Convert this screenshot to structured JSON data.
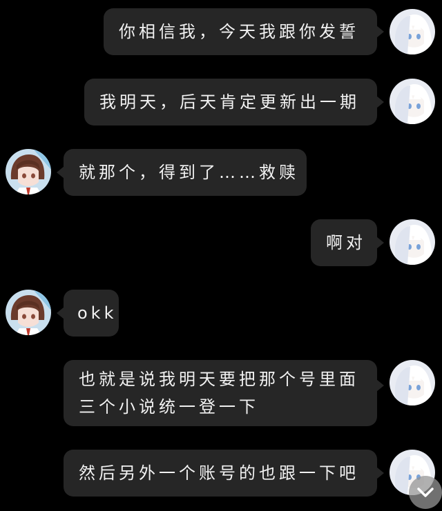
{
  "messages": [
    {
      "side": "right",
      "text": "你相信我，今天我跟你发誓"
    },
    {
      "side": "right",
      "text": "我明天，后天肯定更新出一期"
    },
    {
      "side": "left",
      "text": "就那个，得到了……救赎"
    },
    {
      "side": "right",
      "text": "啊对"
    },
    {
      "side": "left",
      "text": "okk"
    },
    {
      "side": "right",
      "lines": [
        "也就是说我明天要把那个号里面",
        "三个小说统一登一下"
      ]
    },
    {
      "side": "right",
      "text": "然后另外一个账号的也跟一下吧"
    }
  ],
  "icons": {
    "scroll_down": "chevron-down-icon",
    "avatar_self": "avatar-white-hair",
    "avatar_other": "avatar-brown-hair"
  },
  "colors": {
    "background": "#000000",
    "bubble": "#262626",
    "text": "#f2f2f2"
  }
}
